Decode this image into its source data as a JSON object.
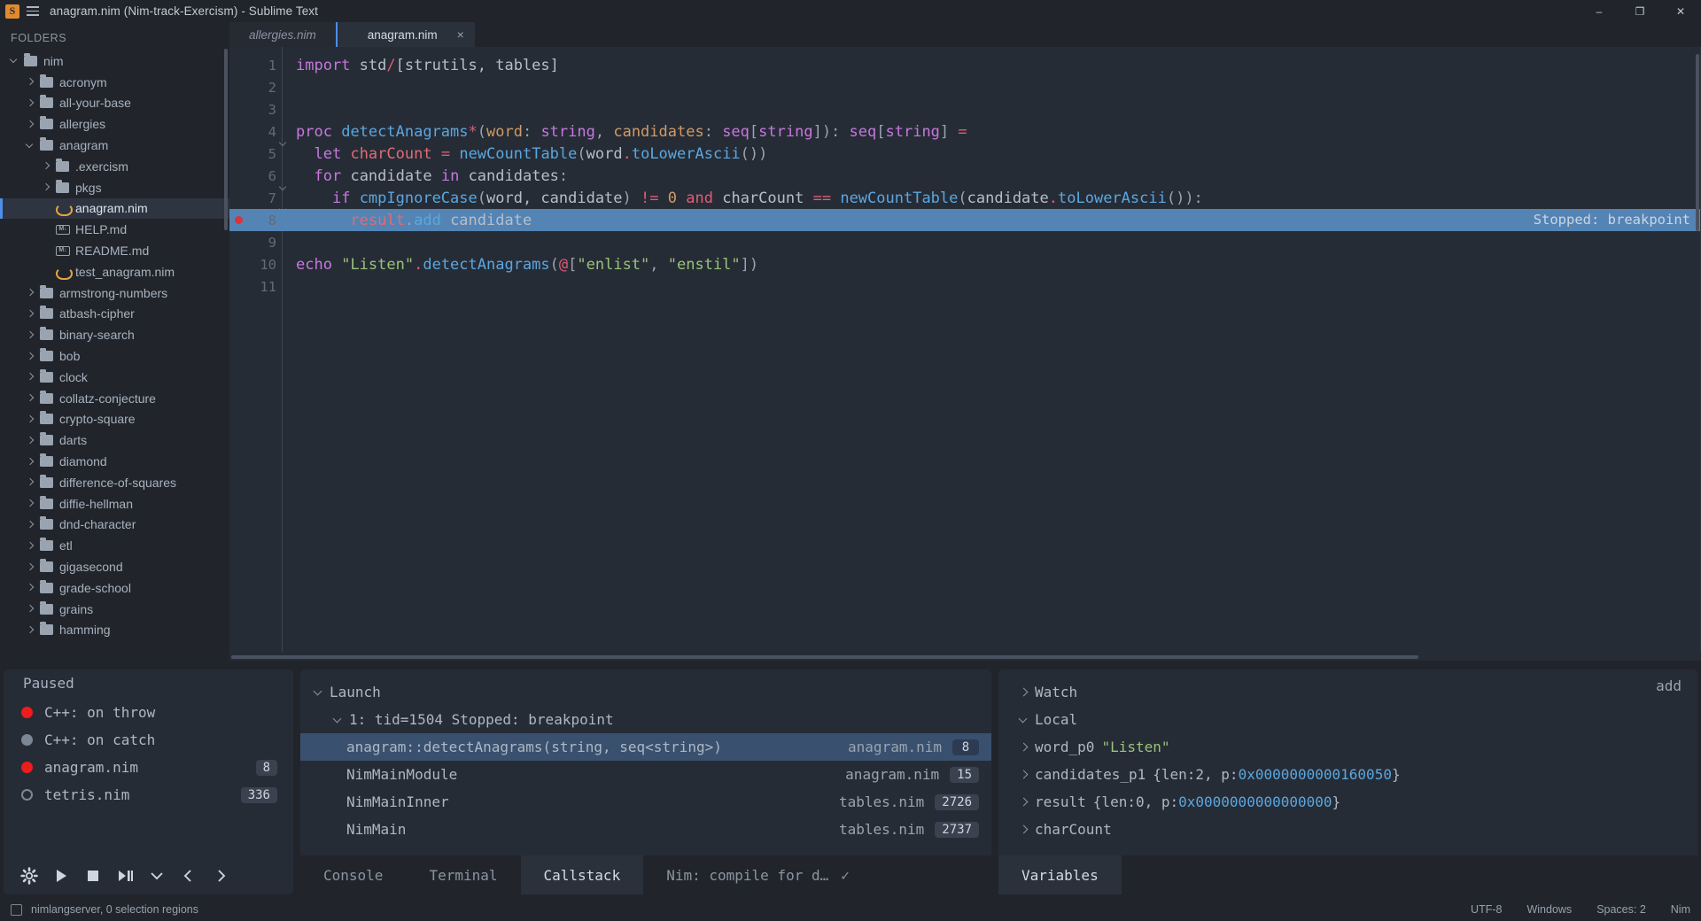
{
  "window": {
    "title": "anagram.nim (Nim-track-Exercism) - Sublime Text",
    "minimize": "–",
    "maximize": "❐",
    "close": "✕"
  },
  "sidebar": {
    "header": "FOLDERS",
    "items": [
      {
        "label": "nim",
        "depth": 0,
        "type": "folder",
        "state": "open",
        "selected": false
      },
      {
        "label": "acronym",
        "depth": 1,
        "type": "folder",
        "state": "closed",
        "selected": false
      },
      {
        "label": "all-your-base",
        "depth": 1,
        "type": "folder",
        "state": "closed",
        "selected": false
      },
      {
        "label": "allergies",
        "depth": 1,
        "type": "folder",
        "state": "closed",
        "selected": false
      },
      {
        "label": "anagram",
        "depth": 1,
        "type": "folder",
        "state": "open",
        "selected": false
      },
      {
        "label": ".exercism",
        "depth": 2,
        "type": "folder",
        "state": "closed",
        "selected": false
      },
      {
        "label": "pkgs",
        "depth": 2,
        "type": "folder",
        "state": "closed",
        "selected": false
      },
      {
        "label": "anagram.nim",
        "depth": 2,
        "type": "nim",
        "state": "none",
        "selected": true
      },
      {
        "label": "HELP.md",
        "depth": 2,
        "type": "md",
        "state": "none",
        "selected": false
      },
      {
        "label": "README.md",
        "depth": 2,
        "type": "md",
        "state": "none",
        "selected": false
      },
      {
        "label": "test_anagram.nim",
        "depth": 2,
        "type": "nim",
        "state": "none",
        "selected": false
      },
      {
        "label": "armstrong-numbers",
        "depth": 1,
        "type": "folder",
        "state": "closed",
        "selected": false
      },
      {
        "label": "atbash-cipher",
        "depth": 1,
        "type": "folder",
        "state": "closed",
        "selected": false
      },
      {
        "label": "binary-search",
        "depth": 1,
        "type": "folder",
        "state": "closed",
        "selected": false
      },
      {
        "label": "bob",
        "depth": 1,
        "type": "folder",
        "state": "closed",
        "selected": false
      },
      {
        "label": "clock",
        "depth": 1,
        "type": "folder",
        "state": "closed",
        "selected": false
      },
      {
        "label": "collatz-conjecture",
        "depth": 1,
        "type": "folder",
        "state": "closed",
        "selected": false
      },
      {
        "label": "crypto-square",
        "depth": 1,
        "type": "folder",
        "state": "closed",
        "selected": false
      },
      {
        "label": "darts",
        "depth": 1,
        "type": "folder",
        "state": "closed",
        "selected": false
      },
      {
        "label": "diamond",
        "depth": 1,
        "type": "folder",
        "state": "closed",
        "selected": false
      },
      {
        "label": "difference-of-squares",
        "depth": 1,
        "type": "folder",
        "state": "closed",
        "selected": false
      },
      {
        "label": "diffie-hellman",
        "depth": 1,
        "type": "folder",
        "state": "closed",
        "selected": false
      },
      {
        "label": "dnd-character",
        "depth": 1,
        "type": "folder",
        "state": "closed",
        "selected": false
      },
      {
        "label": "etl",
        "depth": 1,
        "type": "folder",
        "state": "closed",
        "selected": false
      },
      {
        "label": "gigasecond",
        "depth": 1,
        "type": "folder",
        "state": "closed",
        "selected": false
      },
      {
        "label": "grade-school",
        "depth": 1,
        "type": "folder",
        "state": "closed",
        "selected": false
      },
      {
        "label": "grains",
        "depth": 1,
        "type": "folder",
        "state": "closed",
        "selected": false
      },
      {
        "label": "hamming",
        "depth": 1,
        "type": "folder",
        "state": "closed",
        "selected": false
      }
    ]
  },
  "tabs": [
    {
      "label": "allergies.nim",
      "active": false,
      "closeable": false
    },
    {
      "label": "anagram.nim",
      "active": true,
      "closeable": true,
      "close": "×"
    }
  ],
  "editor": {
    "stopped_overlay": "Stopped: breakpoint",
    "lines": [
      {
        "num": "1",
        "breakpoint": false,
        "fold": false,
        "current": false
      },
      {
        "num": "2",
        "breakpoint": false,
        "fold": false,
        "current": false
      },
      {
        "num": "3",
        "breakpoint": false,
        "fold": false,
        "current": false
      },
      {
        "num": "4",
        "breakpoint": false,
        "fold": true,
        "current": false
      },
      {
        "num": "5",
        "breakpoint": false,
        "fold": false,
        "current": false
      },
      {
        "num": "6",
        "breakpoint": false,
        "fold": true,
        "current": false
      },
      {
        "num": "7",
        "breakpoint": false,
        "fold": true,
        "current": false
      },
      {
        "num": "8",
        "breakpoint": true,
        "fold": false,
        "current": true
      },
      {
        "num": "9",
        "breakpoint": false,
        "fold": false,
        "current": false
      },
      {
        "num": "10",
        "breakpoint": false,
        "fold": false,
        "current": false
      },
      {
        "num": "11",
        "breakpoint": false,
        "fold": false,
        "current": false
      }
    ],
    "source_text": [
      "import std/[strutils, tables]",
      "",
      "",
      "proc detectAnagrams*(word: string, candidates: seq[string]): seq[string] =",
      "  let charCount = newCountTable(word.toLowerAscii())",
      "  for candidate in candidates:",
      "    if cmpIgnoreCase(word, candidate) != 0 and charCount == newCountTable(candidate.toLowerAscii()):",
      "      result.add candidate",
      "",
      "echo \"Listen\".detectAnagrams(@[\"enlist\", \"enstil\"])",
      ""
    ]
  },
  "breakpoints_panel": {
    "title": "Paused",
    "rows": [
      {
        "label": "C++: on throw",
        "dot": "red",
        "count": ""
      },
      {
        "label": "C++: on catch",
        "dot": "grey",
        "count": ""
      },
      {
        "label": "anagram.nim",
        "dot": "red",
        "count": "8"
      },
      {
        "label": "tetris.nim",
        "dot": "hollow",
        "count": "336"
      }
    ],
    "toolbar": [
      {
        "name": "settings-icon"
      },
      {
        "name": "play-icon"
      },
      {
        "name": "stop-icon"
      },
      {
        "name": "step-over-icon"
      },
      {
        "name": "step-into-icon"
      },
      {
        "name": "step-out-left-icon"
      },
      {
        "name": "step-out-right-icon"
      }
    ]
  },
  "callstack_panel": {
    "root": "Launch",
    "thread": "1: tid=1504 Stopped: breakpoint",
    "frames": [
      {
        "name": "anagram::detectAnagrams(string, seq<string>)",
        "file": "anagram.nim",
        "line": "8",
        "selected": true
      },
      {
        "name": "NimMainModule",
        "file": "anagram.nim",
        "line": "15",
        "selected": false
      },
      {
        "name": "NimMainInner",
        "file": "tables.nim",
        "line": "2726",
        "selected": false
      },
      {
        "name": "NimMain",
        "file": "tables.nim",
        "line": "2737",
        "selected": false
      }
    ],
    "tabs": [
      {
        "label": "Console",
        "active": false
      },
      {
        "label": "Terminal",
        "active": false
      },
      {
        "label": "Callstack",
        "active": true
      },
      {
        "label": "Nim: compile for d…",
        "active": false,
        "check": "✓"
      }
    ]
  },
  "variables_panel": {
    "add_label": "add",
    "sections": [
      {
        "label": "Watch",
        "expanded": false
      },
      {
        "label": "Local",
        "expanded": true
      }
    ],
    "locals": [
      {
        "name": "word_p0",
        "value": "\"Listen\"",
        "kind": "string"
      },
      {
        "name": "candidates_p1",
        "value": "{len:2, p:0x0000000000160050}",
        "kind": "pointer"
      },
      {
        "name": "result",
        "value": "{len:0, p:0x0000000000000000}",
        "kind": "pointer"
      },
      {
        "name": "charCount",
        "value": "<null>",
        "kind": "null"
      }
    ],
    "tab": "Variables"
  },
  "statusbar": {
    "left": "nimlangserver, 0 selection regions",
    "encoding": "UTF-8",
    "line_endings": "Windows",
    "indentation": "Spaces: 2",
    "syntax": "Nim"
  },
  "colors": {
    "accent": "#4f8ee8",
    "breakpoint_red": "#d8343c",
    "current_line": "#5484b4",
    "string_green": "#98c379",
    "keyword_purple": "#c678dd",
    "function_blue": "#5aa7e0"
  }
}
